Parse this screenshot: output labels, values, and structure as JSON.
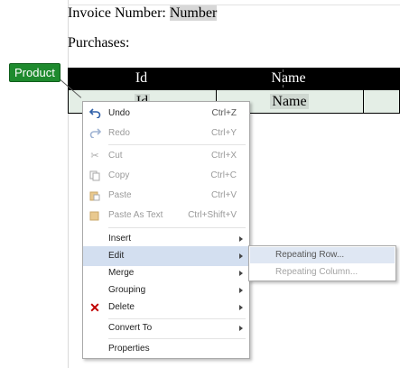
{
  "document": {
    "invoice_label": "Invoice Number:",
    "invoice_field": "Number",
    "purchases_label": "Purchases:",
    "table": {
      "headers": [
        "Id",
        "Name"
      ],
      "row": [
        "Id",
        "Name"
      ]
    },
    "region_tag": "Product"
  },
  "context_menu": {
    "items": [
      {
        "label": "Undo",
        "shortcut": "Ctrl+Z",
        "icon": "undo-icon",
        "enabled": true
      },
      {
        "label": "Redo",
        "shortcut": "Ctrl+Y",
        "icon": "redo-icon",
        "enabled": false
      },
      {
        "label": "Cut",
        "shortcut": "Ctrl+X",
        "icon": "scissors-icon",
        "enabled": false
      },
      {
        "label": "Copy",
        "shortcut": "Ctrl+C",
        "icon": "copy-icon",
        "enabled": false
      },
      {
        "label": "Paste",
        "shortcut": "Ctrl+V",
        "icon": "paste-icon",
        "enabled": false
      },
      {
        "label": "Paste As Text",
        "shortcut": "Ctrl+Shift+V",
        "icon": "paste-text-icon",
        "enabled": false
      },
      {
        "label": "Insert",
        "submenu": true
      },
      {
        "label": "Edit",
        "submenu": true,
        "highlighted": true
      },
      {
        "label": "Merge",
        "submenu": true
      },
      {
        "label": "Grouping",
        "submenu": true
      },
      {
        "label": "Delete",
        "submenu": true,
        "icon": "delete-x-icon"
      },
      {
        "label": "Convert To",
        "submenu": true
      },
      {
        "label": "Properties"
      }
    ]
  },
  "edit_submenu": {
    "items": [
      {
        "label": "Repeating Row...",
        "highlighted": true
      },
      {
        "label": "Repeating Column...",
        "enabled": false
      }
    ]
  },
  "colors": {
    "menu_highlight": "#d3dff0",
    "tag_green": "#1e8a2e",
    "delete_red": "#c00000",
    "icon_blue": "#2e5fa8"
  }
}
